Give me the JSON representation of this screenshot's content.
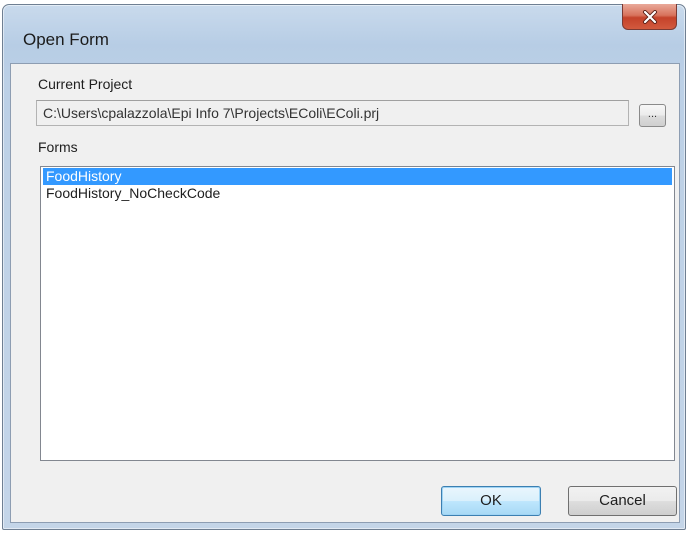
{
  "window": {
    "title": "Open Form"
  },
  "project": {
    "label": "Current Project",
    "path": "C:\\Users\\cpalazzola\\Epi Info 7\\Projects\\EColi\\EColi.prj",
    "browse_label": "..."
  },
  "forms": {
    "label": "Forms",
    "items": [
      {
        "label": "FoodHistory",
        "selected": true
      },
      {
        "label": "FoodHistory_NoCheckCode",
        "selected": false
      }
    ]
  },
  "buttons": {
    "ok_label": "OK",
    "cancel_label": "Cancel"
  },
  "icons": {
    "close": "close-icon"
  },
  "colors": {
    "selection": "#3399ff",
    "close_button": "#c4422a",
    "default_button_border": "#3c7fb1"
  }
}
